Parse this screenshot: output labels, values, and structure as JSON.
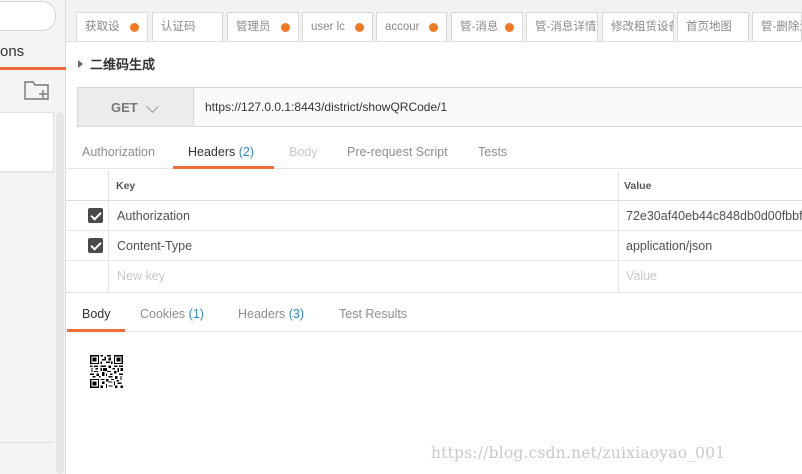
{
  "sidebar": {
    "tab_label": "ons"
  },
  "tabs": [
    {
      "label": "获取设",
      "dot": true
    },
    {
      "label": "认证码",
      "dot": false
    },
    {
      "label": "管理员",
      "dot": true
    },
    {
      "label": "user lc",
      "dot": true
    },
    {
      "label": "accour",
      "dot": true
    },
    {
      "label": "管-消息",
      "dot": true
    },
    {
      "label": "管-消息详情",
      "dot": false
    },
    {
      "label": "修改租赁设备",
      "dot": false
    },
    {
      "label": "首页地图",
      "dot": false
    },
    {
      "label": "管-删除消",
      "dot": false
    }
  ],
  "request": {
    "name": "二维码生成",
    "method": "GET",
    "url": "https://127.0.0.1:8443/district/showQRCode/1"
  },
  "request_tabs": [
    {
      "label": "Authorization",
      "count": ""
    },
    {
      "label": "Headers",
      "count": "(2)"
    },
    {
      "label": "Body",
      "count": ""
    },
    {
      "label": "Pre-request Script",
      "count": ""
    },
    {
      "label": "Tests",
      "count": ""
    }
  ],
  "headers_table": {
    "key_header": "Key",
    "value_header": "Value",
    "rows": [
      {
        "key": "Authorization",
        "value": "72e30af40eb44c848db0d00fbbf",
        "checked": true
      },
      {
        "key": "Content-Type",
        "value": "application/json",
        "checked": true
      }
    ],
    "new_key_placeholder": "New key",
    "new_value_placeholder": "Value"
  },
  "response_tabs": [
    {
      "label": "Body",
      "count": ""
    },
    {
      "label": "Cookies",
      "count": "(1)"
    },
    {
      "label": "Headers",
      "count": "(3)"
    },
    {
      "label": "Test Results",
      "count": ""
    }
  ],
  "watermark": "https://blog.csdn.net/zuixiaoyao_001",
  "colors": {
    "accent": "#f26b3a",
    "dot": "#f07a22",
    "count": "#2d8ccd"
  }
}
